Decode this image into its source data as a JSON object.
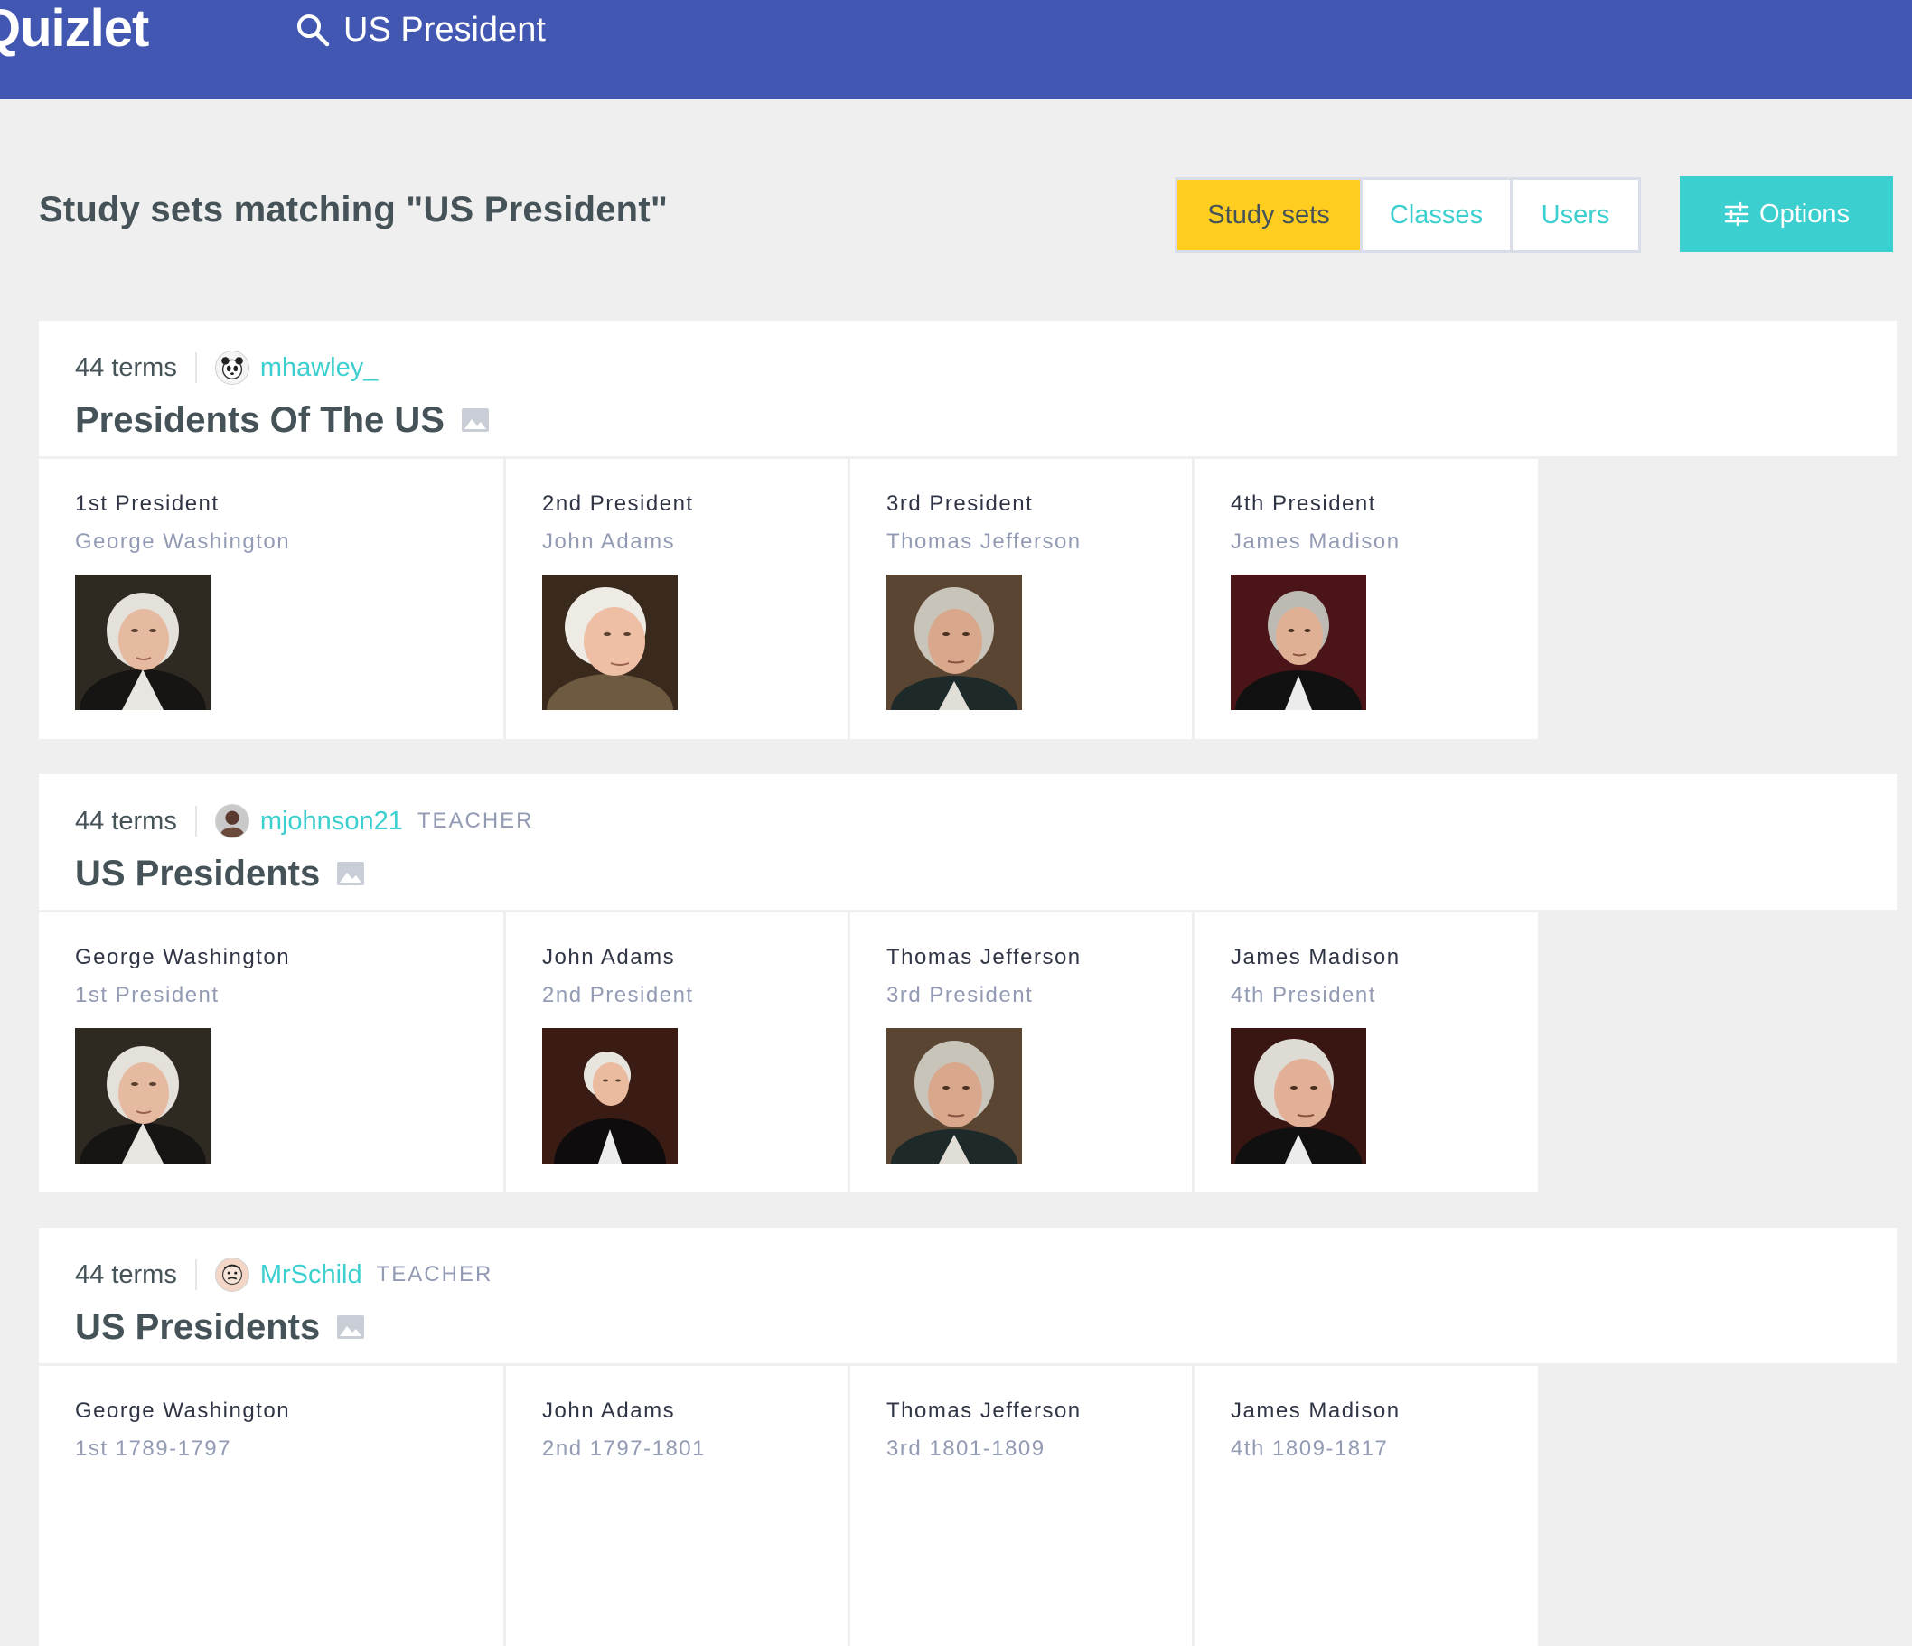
{
  "header": {
    "logo": "Quizlet",
    "search_query": "US President"
  },
  "page": {
    "heading": "Study sets matching \"US President\"",
    "filters": [
      {
        "label": "Study sets",
        "active": true
      },
      {
        "label": "Classes",
        "active": false
      },
      {
        "label": "Users",
        "active": false
      }
    ],
    "options_label": "Options"
  },
  "colors": {
    "brand": "#4257b2",
    "accent": "#3ccfcf",
    "active_filter": "#ffcd1f"
  },
  "sets": [
    {
      "terms": "44 terms",
      "username": "mhawley_",
      "role": "",
      "title": "Presidents Of The US",
      "cards": [
        {
          "term": "1st President",
          "definition": "George Washington",
          "portrait": "george-washington"
        },
        {
          "term": "2nd President",
          "definition": "John Adams",
          "portrait": "john-adams"
        },
        {
          "term": "3rd President",
          "definition": "Thomas Jefferson",
          "portrait": "thomas-jefferson"
        },
        {
          "term": "4th President",
          "definition": "James Madison",
          "portrait": "james-madison"
        }
      ]
    },
    {
      "terms": "44 terms",
      "username": "mjohnson21",
      "role": "TEACHER",
      "title": "US Presidents",
      "cards": [
        {
          "term": "George Washington",
          "definition": "1st President",
          "portrait": "george-washington"
        },
        {
          "term": "John Adams",
          "definition": "2nd President",
          "portrait": "john-adams"
        },
        {
          "term": "Thomas Jefferson",
          "definition": "3rd President",
          "portrait": "thomas-jefferson"
        },
        {
          "term": "James Madison",
          "definition": "4th President",
          "portrait": "james-madison"
        }
      ]
    },
    {
      "terms": "44 terms",
      "username": "MrSchild",
      "role": "TEACHER",
      "title": "US Presidents",
      "cards": [
        {
          "term": "George Washington",
          "definition": "1st 1789-1797",
          "portrait": "george-washington"
        },
        {
          "term": "John Adams",
          "definition": "2nd 1797-1801",
          "portrait": "john-adams"
        },
        {
          "term": "Thomas Jefferson",
          "definition": "3rd 1801-1809",
          "portrait": "thomas-jefferson"
        },
        {
          "term": "James Madison",
          "definition": "4th 1809-1817",
          "portrait": "james-madison"
        }
      ]
    }
  ]
}
